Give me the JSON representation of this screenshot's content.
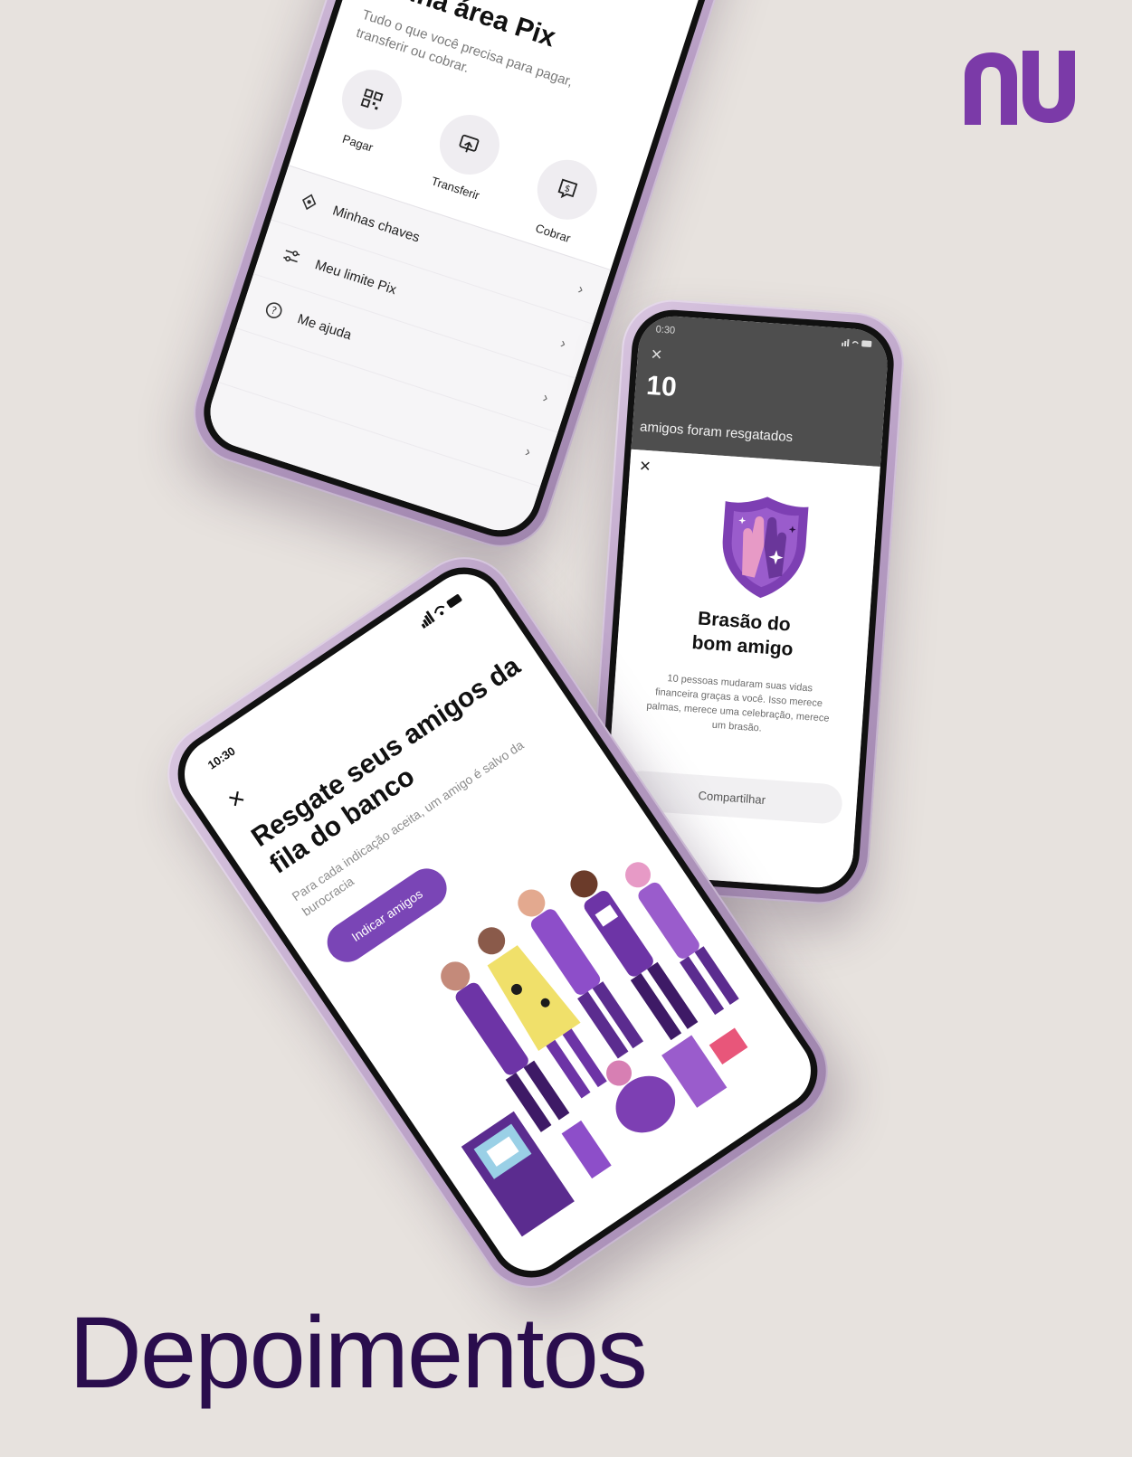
{
  "brand": {
    "logo_text": "nu",
    "accent": "#820ad1",
    "logo_color": "#7b3aa8",
    "headline": "Depoimentos",
    "headline_color": "#2a0d4d"
  },
  "phone_pix": {
    "title": "Minha área Pix",
    "subtitle": "Tudo o que você precisa para pagar, transferir ou cobrar.",
    "actions": [
      {
        "label": "Pagar",
        "icon": "qr-code-icon"
      },
      {
        "label": "Transferir",
        "icon": "transfer-icon"
      },
      {
        "label": "Cobrar",
        "icon": "charge-icon"
      }
    ],
    "list": [
      {
        "label": "Minhas chaves",
        "icon": "keys-icon"
      },
      {
        "label": "Meu limite Pix",
        "icon": "sliders-icon"
      },
      {
        "label": "Me ajuda",
        "icon": "help-icon"
      }
    ]
  },
  "phone_badge": {
    "status_time": "0:30",
    "count": "10",
    "count_label": "amigos foram resgatados",
    "title": "Brasão do\nbom amigo",
    "description": "10 pessoas mudaram suas vidas financeira graças a você. Isso merece palmas, merece uma celebração, merece um brasão.",
    "share_label": "Compartilhar"
  },
  "phone_referral": {
    "status_time": "10:30",
    "title": "Resgate seus amigos da fila do banco",
    "subtitle": "Para cada indicação aceita, um amigo é salvo da burocracia",
    "cta_label": "Indicar amigos"
  }
}
